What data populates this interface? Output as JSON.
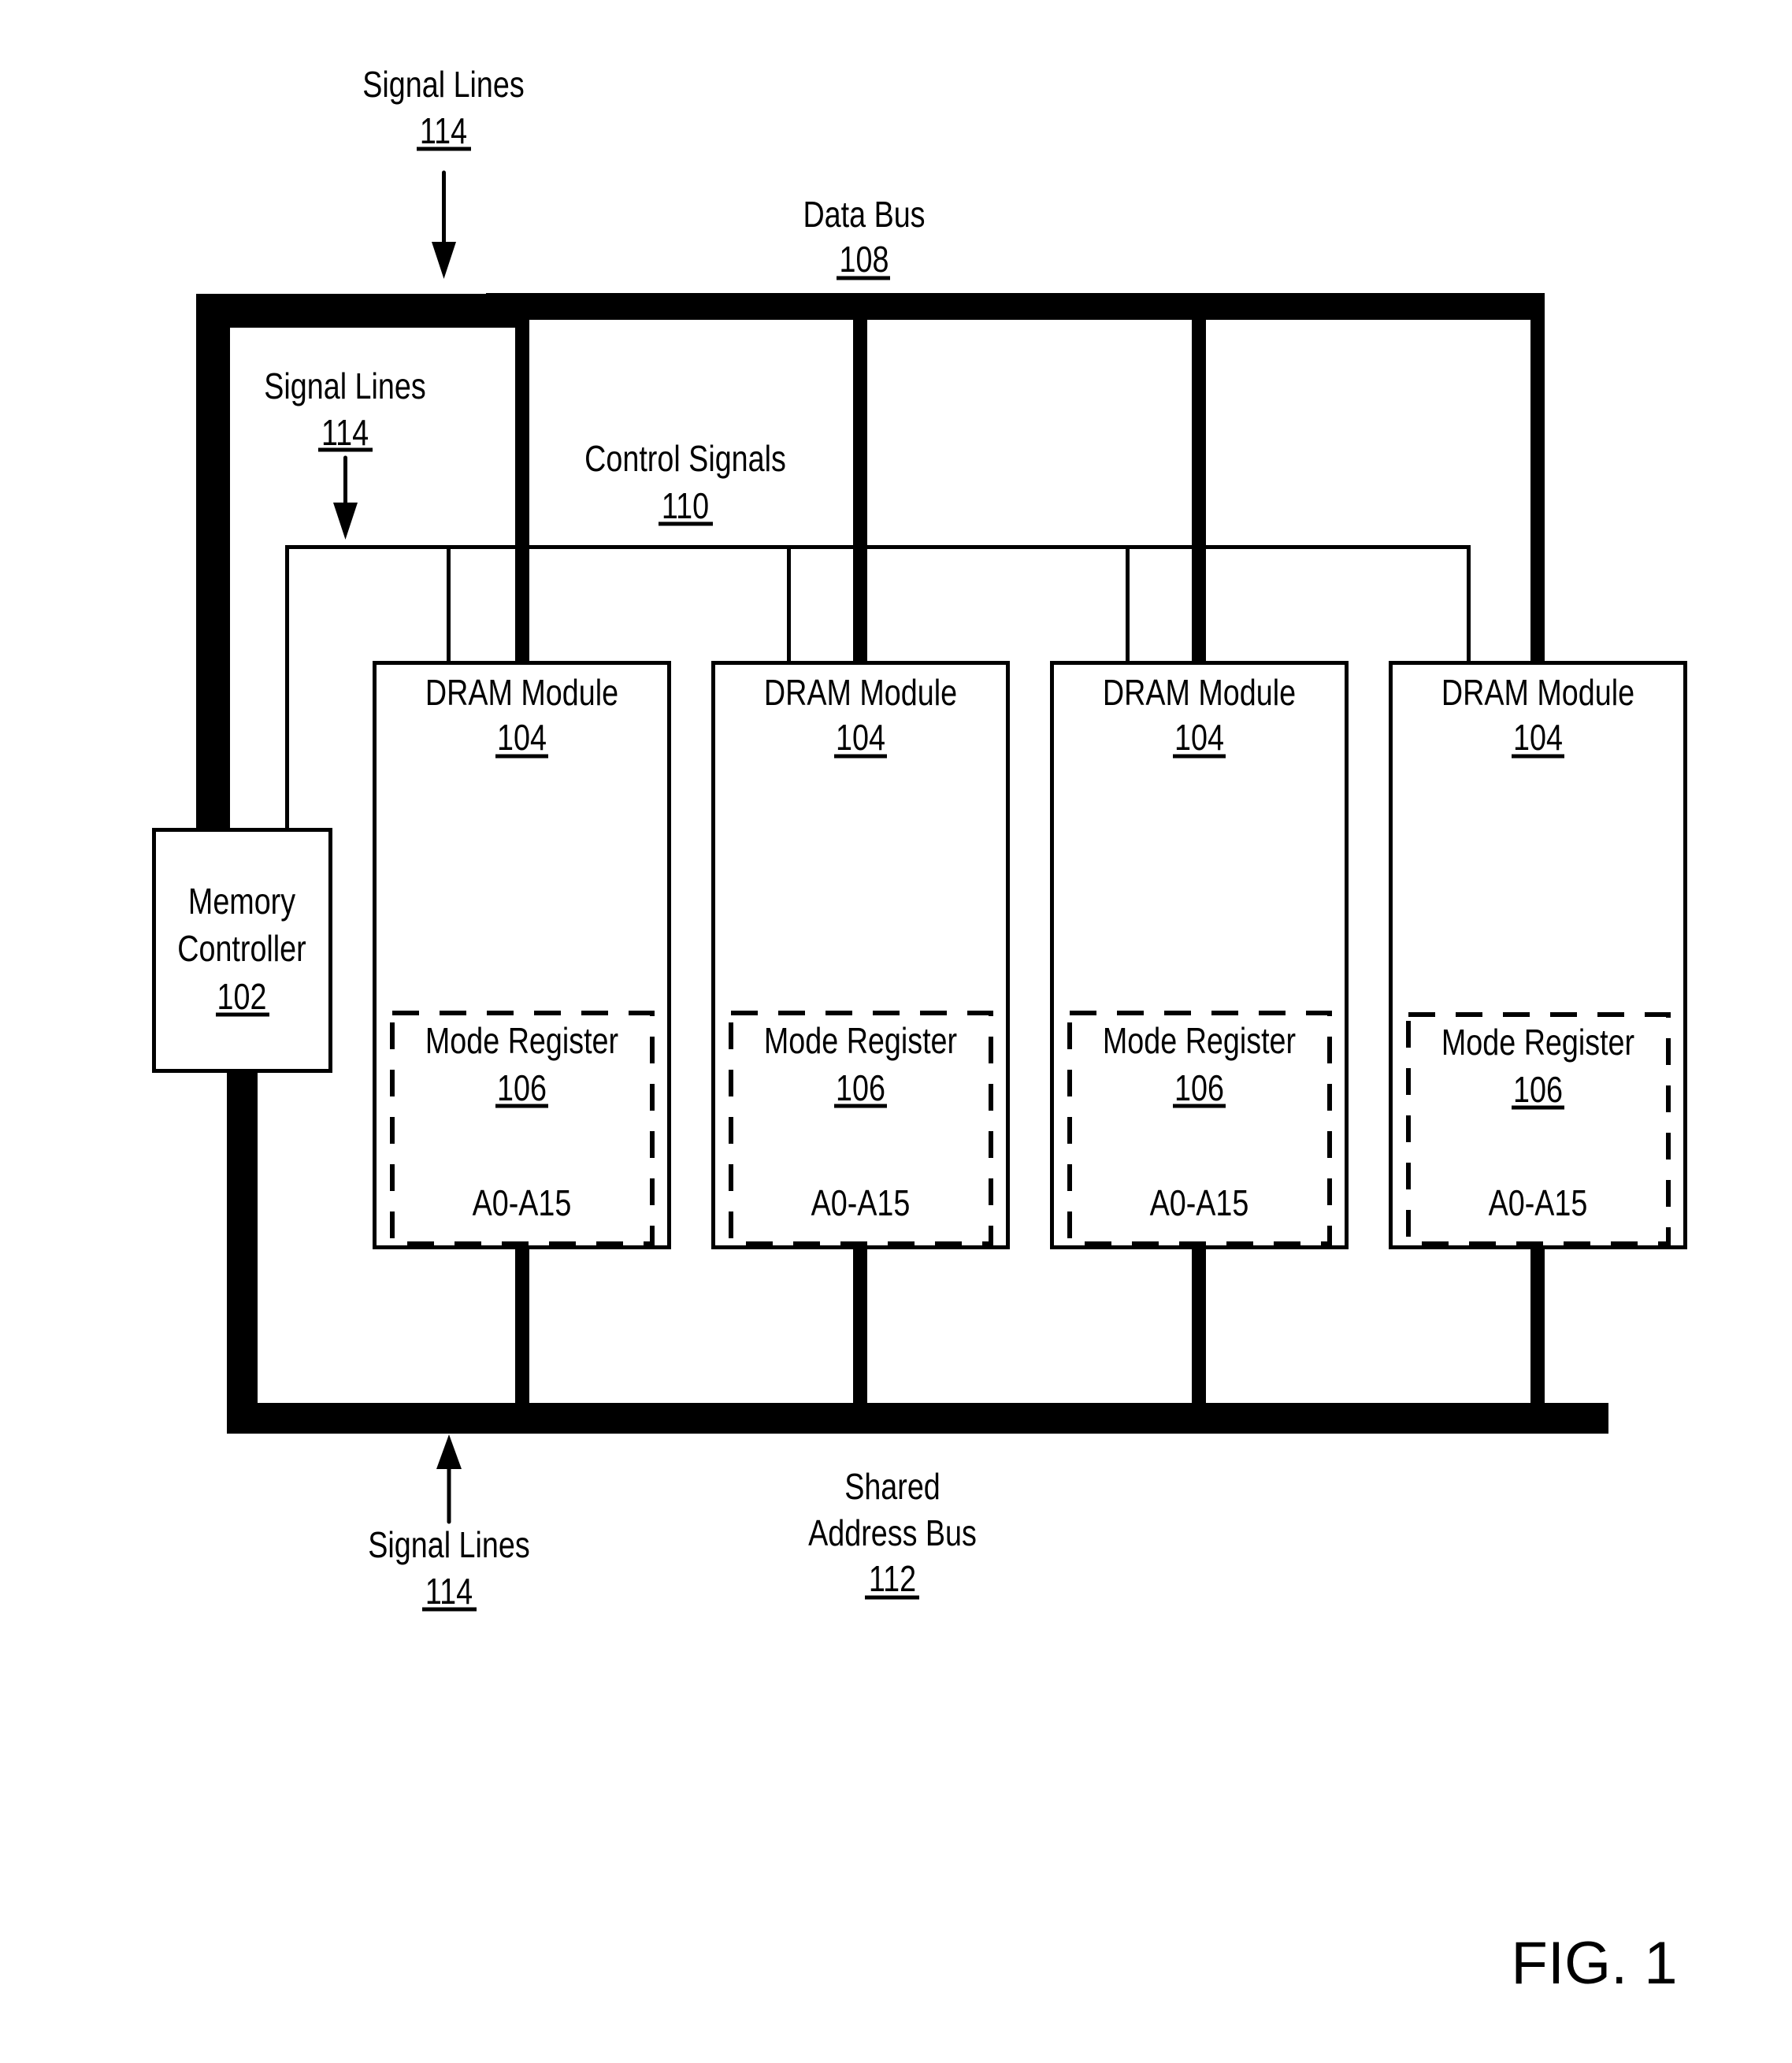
{
  "figure": {
    "caption": "FIG. 1",
    "colors": {
      "line": "#000000",
      "background": "#ffffff"
    }
  },
  "signal_lines_top": {
    "label": "Signal Lines",
    "ref": "114"
  },
  "signal_lines_inner": {
    "label": "Signal Lines",
    "ref": "114"
  },
  "signal_lines_bottom": {
    "label": "Signal Lines",
    "ref": "114"
  },
  "data_bus": {
    "label": "Data Bus",
    "ref": "108"
  },
  "control_signals": {
    "label": "Control Signals",
    "ref": "110"
  },
  "shared_address_bus": {
    "label_line1": "Shared",
    "label_line2": "Address Bus",
    "ref": "112"
  },
  "memory_controller": {
    "label_line1": "Memory",
    "label_line2": "Controller",
    "ref": "102"
  },
  "dram_modules": [
    {
      "label": "DRAM Module",
      "ref": "104",
      "mode_register": {
        "label": "Mode Register",
        "ref": "106",
        "pins": "A0-A15"
      }
    },
    {
      "label": "DRAM Module",
      "ref": "104",
      "mode_register": {
        "label": "Mode Register",
        "ref": "106",
        "pins": "A0-A15"
      }
    },
    {
      "label": "DRAM Module",
      "ref": "104",
      "mode_register": {
        "label": "Mode Register",
        "ref": "106",
        "pins": "A0-A15"
      }
    },
    {
      "label": "DRAM Module",
      "ref": "104",
      "mode_register": {
        "label": "Mode Register",
        "ref": "106",
        "pins": "A0-A15"
      }
    }
  ]
}
